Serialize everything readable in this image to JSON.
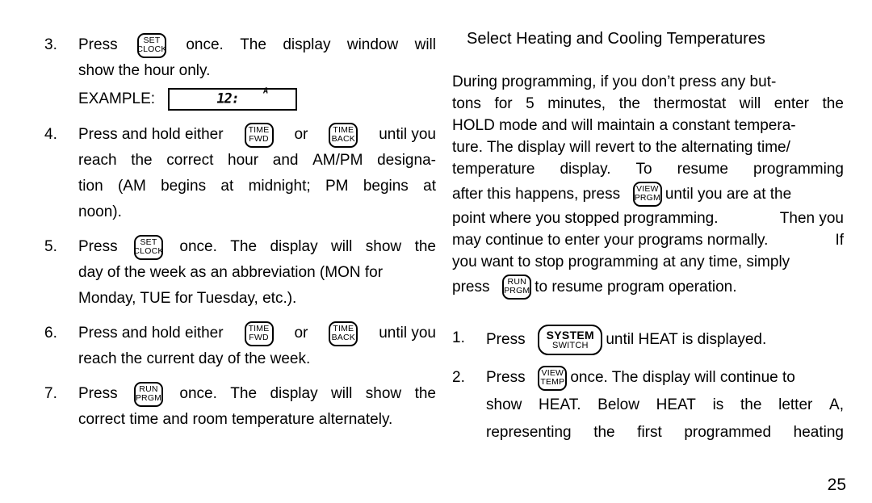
{
  "page": {
    "number": "25",
    "background": "#ffffff",
    "text_color": "#000000"
  },
  "left_column": {
    "steps": [
      {
        "number": "3.",
        "lines": [
          {
            "parts": [
              "Press",
              "KEY:set-clock",
              "once.",
              "The",
              "display",
              "window",
              "will"
            ],
            "justify": true
          },
          {
            "parts": [
              "show the hour only."
            ],
            "justify": false
          }
        ],
        "example": {
          "label": "EXAMPLE:",
          "lcd_time": "12:",
          "lcd_ampm": "A"
        }
      },
      {
        "number": "4.",
        "lines": [
          {
            "parts": [
              "Press and hold either",
              "KEY:time-fwd",
              "or",
              "KEY:time-back",
              "until you"
            ],
            "justify": true
          },
          {
            "parts": [
              "reach",
              "the",
              "correct",
              "hour",
              "and",
              "AM/PM",
              "designa-"
            ],
            "justify": true
          },
          {
            "parts": [
              "tion",
              "(AM",
              "begins",
              "at",
              "midnight;",
              "PM",
              "begins",
              "at"
            ],
            "justify": true
          },
          {
            "parts": [
              "noon)."
            ],
            "justify": false
          }
        ]
      },
      {
        "number": "5.",
        "lines": [
          {
            "parts": [
              "Press",
              "KEY:set-clock",
              "once.",
              "The",
              "display",
              "will",
              "show",
              "the"
            ],
            "justify": true
          },
          {
            "parts": [
              "day of the week as an abbreviation (MON for"
            ],
            "justify": false
          },
          {
            "parts": [
              "Monday, TUE for Tuesday, etc.)."
            ],
            "justify": false
          }
        ]
      },
      {
        "number": "6.",
        "lines": [
          {
            "parts": [
              "Press and hold either",
              "KEY:time-fwd",
              "or",
              "KEY:time-back",
              "until you"
            ],
            "justify": true
          },
          {
            "parts": [
              "reach the current day of the week."
            ],
            "justify": false
          }
        ]
      },
      {
        "number": "7.",
        "lines": [
          {
            "parts": [
              "Press",
              "KEY:run-prgm",
              "once.",
              "The",
              "display",
              "will",
              "show",
              "the"
            ],
            "justify": true
          },
          {
            "parts": [
              "correct time and room temperature alternately."
            ],
            "justify": false
          }
        ]
      }
    ]
  },
  "right_column": {
    "title": "Select Heating and Cooling Temperatures",
    "paragraph_lines": [
      {
        "parts": [
          "During programming, if you don’t press any but-"
        ],
        "justify": false
      },
      {
        "parts": [
          "tons",
          "for",
          "5",
          "minutes,",
          "the",
          "thermostat",
          "will",
          "enter",
          "the"
        ],
        "justify": true
      },
      {
        "parts": [
          "HOLD mode and will maintain a constant tempera-"
        ],
        "justify": false
      },
      {
        "parts": [
          "ture. The display will revert to the alternating time/"
        ],
        "justify": false
      },
      {
        "parts": [
          "temperature",
          "display.",
          "To",
          "resume",
          "programming"
        ],
        "justify": true
      },
      {
        "parts": [
          "after this happens, press",
          "KEY:view-prgm",
          "until you are at the"
        ],
        "justify": false,
        "tall": true
      },
      {
        "parts": [
          "point where you stopped programming.",
          "Then you"
        ],
        "justify": true
      },
      {
        "parts": [
          "may continue to enter your programs normally.",
          "If"
        ],
        "justify": true
      },
      {
        "parts": [
          "you want to stop programming at any time, simply"
        ],
        "justify": false
      },
      {
        "parts": [
          "press",
          "KEY:run-prgm",
          "to resume program operation."
        ],
        "justify": false,
        "tall": true
      }
    ],
    "steps": [
      {
        "number": "1.",
        "lines": [
          {
            "parts": [
              "Press",
              "KEY:system-switch",
              "until HEAT is displayed."
            ],
            "justify": false
          }
        ]
      },
      {
        "number": "2.",
        "lines": [
          {
            "parts": [
              "Press",
              "KEY:view-temp",
              "once. The display will continue to"
            ],
            "justify": false
          },
          {
            "parts": [
              "show",
              "HEAT.",
              "Below",
              "HEAT",
              "is",
              "the",
              "letter",
              "A,"
            ],
            "justify": true
          },
          {
            "parts": [
              "representing",
              "the",
              "first",
              "programmed",
              "heating"
            ],
            "justify": true
          }
        ]
      }
    ]
  },
  "keys": {
    "set-clock": {
      "line1": "SET",
      "line2": "CLOCK",
      "wide": false
    },
    "time-fwd": {
      "line1": "TIME",
      "line2": "FWD",
      "wide": false
    },
    "time-back": {
      "line1": "TIME",
      "line2": "BACK",
      "wide": false
    },
    "run-prgm": {
      "line1": "RUN",
      "line2": "PRGM",
      "wide": false
    },
    "view-prgm": {
      "line1": "VIEW",
      "line2": "PRGM",
      "wide": false
    },
    "view-temp": {
      "line1": "VIEW",
      "line2": "TEMP",
      "wide": false
    },
    "system-switch": {
      "line1": "SYSTEM",
      "line2": "SWITCH",
      "wide": true
    }
  }
}
